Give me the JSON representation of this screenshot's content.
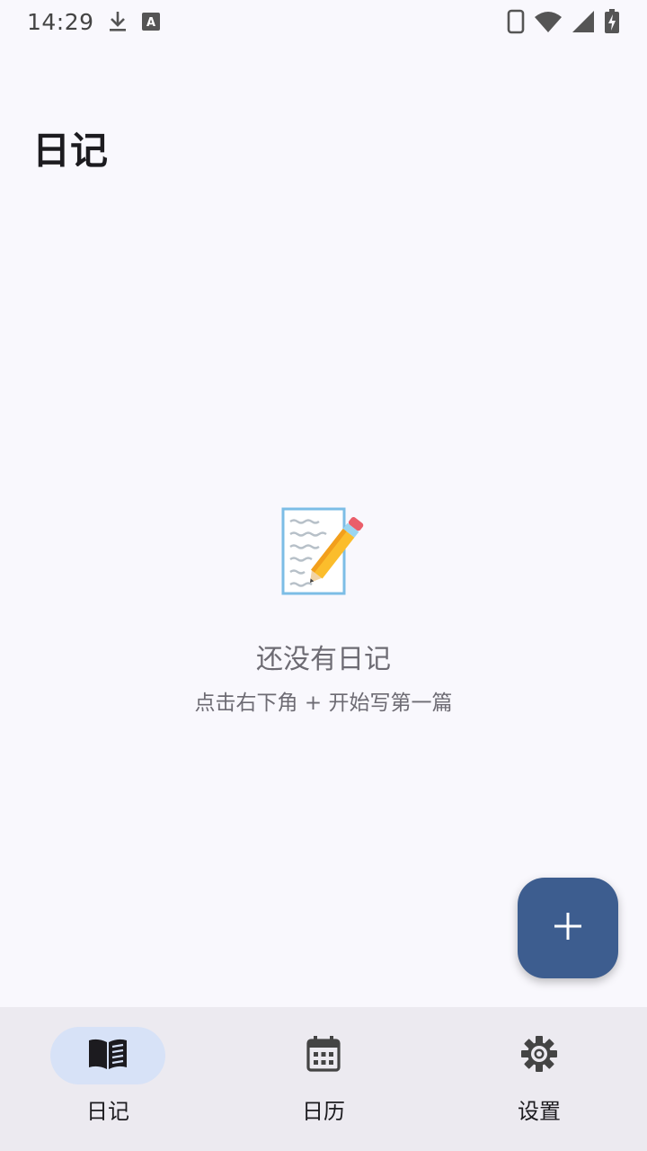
{
  "status_bar": {
    "time": "14:29",
    "left_icons": [
      "download-icon",
      "keyboard-a-icon"
    ],
    "right_icons": [
      "phone-icon",
      "wifi-icon",
      "signal-icon",
      "battery-charging-icon"
    ]
  },
  "header": {
    "title": "日记"
  },
  "empty_state": {
    "icon": "memo-pencil-icon",
    "title": "还没有日记",
    "subtitle": "点击右下角 + 开始写第一篇"
  },
  "fab": {
    "icon": "plus-icon"
  },
  "bottom_nav": {
    "items": [
      {
        "label": "日记",
        "icon": "book-icon",
        "active": true
      },
      {
        "label": "日历",
        "icon": "calendar-icon",
        "active": false
      },
      {
        "label": "设置",
        "icon": "gear-icon",
        "active": false
      }
    ]
  },
  "colors": {
    "background": "#f9f8fd",
    "fab": "#3d5d8f",
    "nav_background": "#eceaf0",
    "nav_active_indicator": "#d7e2f7"
  }
}
